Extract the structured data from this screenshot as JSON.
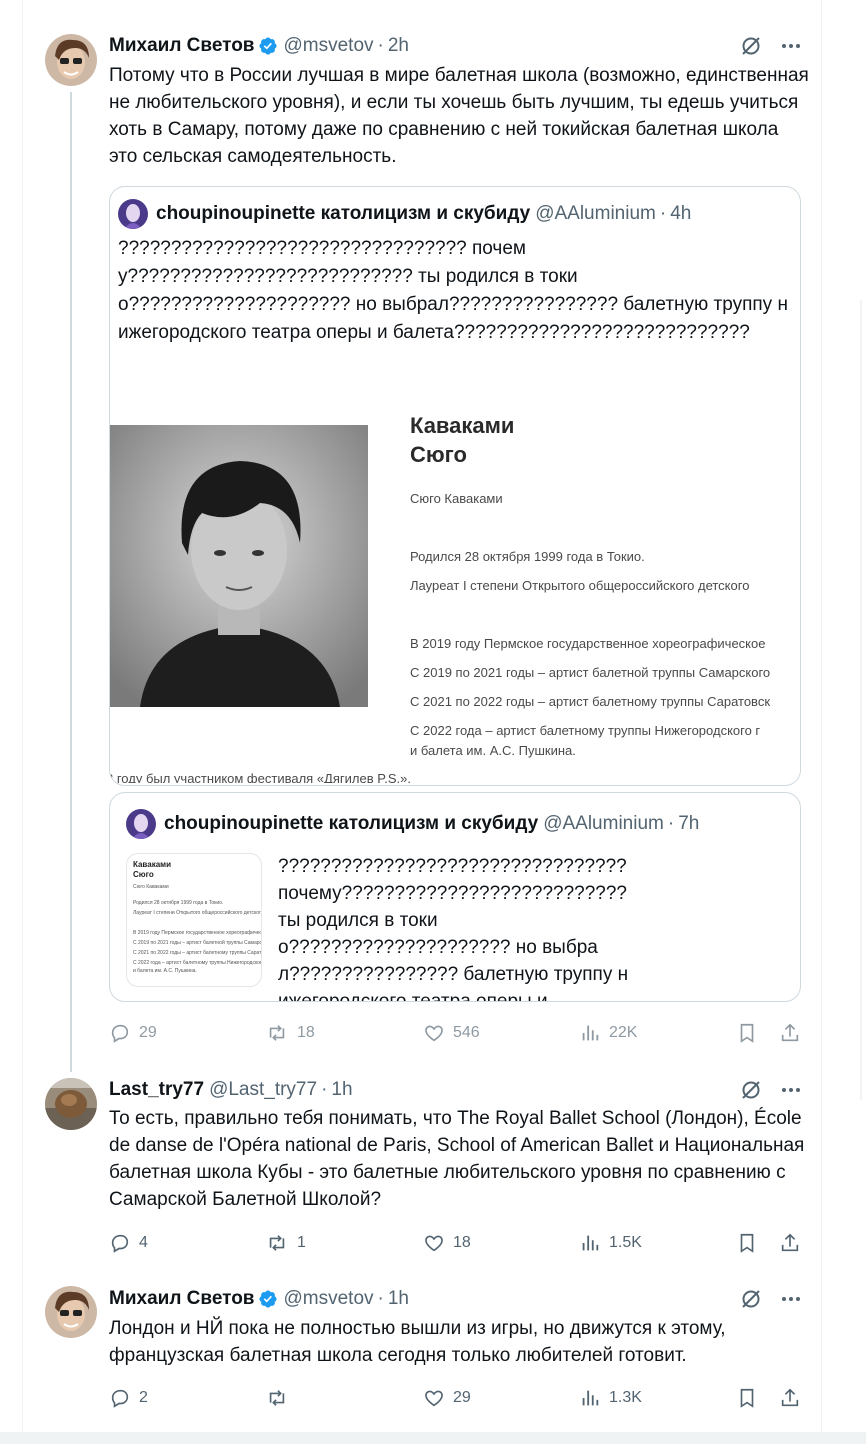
{
  "colors": {
    "accent": "#1d9bf0",
    "text": "#0f1419",
    "muted": "#536471",
    "border": "#cfd9de"
  },
  "tweets": [
    {
      "name": "Михаил Светов",
      "handle": "@msvetov",
      "time": "2h",
      "verified": true,
      "text": "Потому что в России лучшая в мире балетная школа (возможно, единственная не любительского уровня), и если ты хочешь быть лучшим, ты едешь учиться хоть в Самару, потому даже по сравнению с ней токийская балетная школа это сельская самодеятельность.",
      "quote": {
        "name": "choupinoupinette католицизм и скубиду",
        "handle": "@AAluminium",
        "time": "4h",
        "text": "????????????????????????????????? почему??????????????????????????? ты родился в токио????????????????????? но выбрал???????????????? балетную труппу нижегородского театра оперы и балета????????????????????????????",
        "card": {
          "title_line1": "Каваками",
          "title_line2": "Сюго",
          "subtitle": "Сюго Каваками",
          "lines": [
            "Родился 28 октября 1999 года в Токио.",
            "Лауреат I степени Открытого общероссийского детского",
            "В 2019 году Пермское государственное хореографическое",
            "С 2019 по 2021 годы – артист балетной труппы Самарского",
            "С 2021 по 2022 годы – артист балетному труппы Саратовск",
            "С 2022 года – артист балетному труппы Нижегородского г",
            "и балета им. А.С. Пушкина.",
            "3 году был участником фестиваля «Дягилев P.S.»."
          ]
        }
      },
      "quote2": {
        "name": "choupinoupinette католицизм и скубиду",
        "handle": "@AAluminium",
        "time": "7h",
        "text": "????????????????????????????????? почему??????????????????????????? ты родился в токио????????????????????? но выбрал???????????????? балетную труппу нижегородского театра оперы и ..."
      },
      "stats": {
        "replies": "29",
        "reposts": "18",
        "likes": "546",
        "views": "22K"
      }
    },
    {
      "name": "Last_try77",
      "handle": "@Last_try77",
      "time": "1h",
      "verified": false,
      "text": "То есть, правильно тебя понимать, что The Royal Ballet School (Лондон), École de danse de l'Opéra national de Paris, School of American Ballet и Национальная балетная школа Кубы - это балетные любительского уровня по сравнению с Самарской Балетной Школой?",
      "stats": {
        "replies": "4",
        "reposts": "1",
        "likes": "18",
        "views": "1.5K"
      }
    },
    {
      "name": "Михаил Светов",
      "handle": "@msvetov",
      "time": "1h",
      "verified": true,
      "text": "Лондон и НЙ пока не полностью вышли из игры, но движутся к этому, французская балетная школа сегодня только любителей готовит.",
      "stats": {
        "replies": "2",
        "reposts": "",
        "likes": "29",
        "views": "1.3K"
      }
    }
  ],
  "separator": "·"
}
